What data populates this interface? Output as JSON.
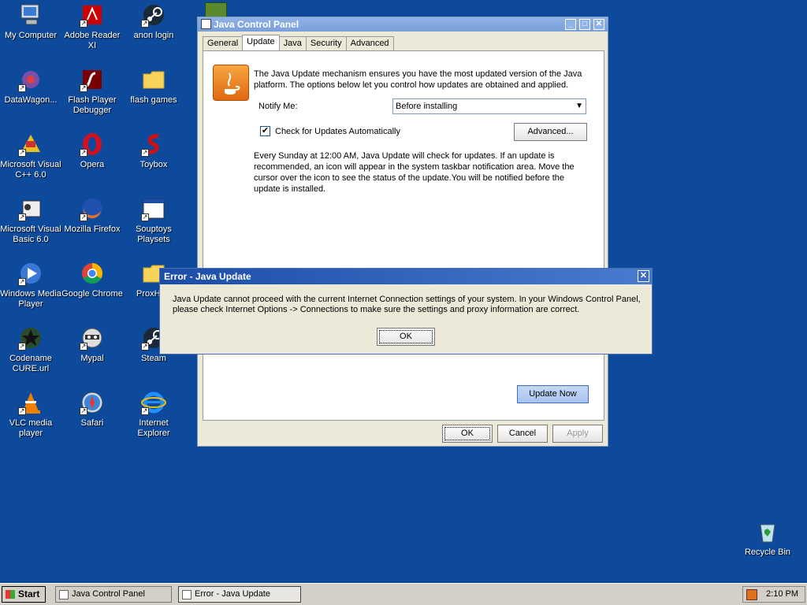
{
  "desktop": {
    "icons": [
      {
        "label": "My Computer"
      },
      {
        "label": "Adobe Reader XI"
      },
      {
        "label": "anon login"
      },
      {
        "label": "DataWagon..."
      },
      {
        "label": "Flash Player Debugger"
      },
      {
        "label": "flash games"
      },
      {
        "label": "Microsoft Visual C++ 6.0"
      },
      {
        "label": "Opera"
      },
      {
        "label": "Toybox"
      },
      {
        "label": "Microsoft Visual Basic 6.0"
      },
      {
        "label": "Mozilla Firefox"
      },
      {
        "label": "Souptoys Playsets"
      },
      {
        "label": "Windows Media Player"
      },
      {
        "label": "Google Chrome"
      },
      {
        "label": "ProxHTT"
      },
      {
        "label": "Codename CURE.url"
      },
      {
        "label": "Mypal"
      },
      {
        "label": "Steam"
      },
      {
        "label": "VLC media player"
      },
      {
        "label": "Safari"
      },
      {
        "label": "Internet Explorer"
      },
      {
        "label": "Recycle Bin"
      }
    ]
  },
  "java_window": {
    "title": "Java Control Panel",
    "tabs": [
      {
        "label": "General"
      },
      {
        "label": "Update"
      },
      {
        "label": "Java"
      },
      {
        "label": "Security"
      },
      {
        "label": "Advanced"
      }
    ],
    "intro": "The Java Update mechanism ensures you have the most updated version of the Java platform. The options below let you control how updates are obtained and applied.",
    "notify_label": "Notify Me:",
    "notify_value": "Before installing",
    "check_label": "Check for Updates Automatically",
    "advanced_button": "Advanced...",
    "schedule_text": "Every Sunday at 12:00 AM, Java Update will check for updates. If an update is recommended, an icon will appear in the system taskbar notification area. Move the cursor over the icon to see the status of the update.You will be notified before the update is installed.",
    "update_now": "Update Now",
    "ok": "OK",
    "cancel": "Cancel",
    "apply": "Apply"
  },
  "error_dialog": {
    "title": "Error - Java Update",
    "message_line1": "Java Update cannot proceed with the current Internet Connection settings of your system.  In your Windows Control Panel,",
    "message_line2": "please check Internet Options -> Connections to make sure the settings and proxy information are correct.",
    "ok": "OK",
    "close_glyph": "✕"
  },
  "taskbar": {
    "start": "Start",
    "items": [
      {
        "label": "Java Control Panel"
      },
      {
        "label": "Error - Java Update"
      }
    ],
    "clock": "2:10 PM"
  }
}
